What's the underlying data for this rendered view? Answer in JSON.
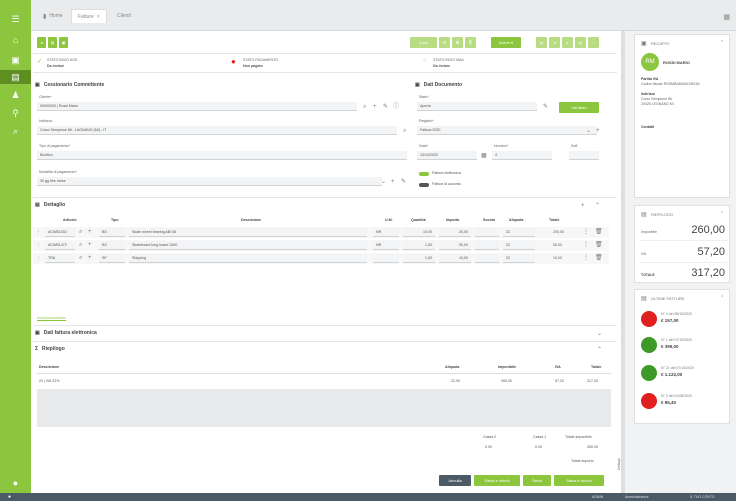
{
  "tabs": [
    {
      "label": "Home"
    },
    {
      "label": "Fatture"
    },
    {
      "label": "Clienti"
    }
  ],
  "toolbar": {
    "btn_invia": "Invia",
    "btn_azioni": "Azioni"
  },
  "status": {
    "invio_label": "STATO INVIO ASD",
    "invio_value": "Da inviare",
    "pag_label": "STATO PAGAMENTO",
    "pag_value": "Non pagato",
    "inv_label": "STATO INVIO MAIL",
    "inv_value": "Da inviare"
  },
  "cessionario": {
    "title": "Cessionario Committente",
    "cliente_label": "Cliente*",
    "cliente_value": "00000002 | Rossi Mario",
    "indirizzo_label": "Indirizzo",
    "indirizzo_value": "Corso Sempione 86 - LAGNANO (MI) - IT",
    "tipo_pag_label": "Tipo di pagamento*",
    "tipo_pag_value": "Bonifico",
    "modalita_label": "Modalità di pagamento*",
    "modalita_value": "30 gg fine mese"
  },
  "documento": {
    "title": "Dati Documento",
    "stato_label": "Stato*",
    "stato_value": "Aperta",
    "registro_label": "Registro*",
    "registro_value": "Fattura 2020",
    "data_label": "Data*",
    "data_value": "13/10/2020",
    "numero_label": "Numero*",
    "numero_value": "4",
    "suff_label": "Suff.",
    "action_btn": "Vai aiuto",
    "toggle1": "Fattura elettronica",
    "toggle2": "Fattura di acconto"
  },
  "dettaglio": {
    "title": "Dettaglio",
    "columns": [
      "Articolo",
      "Tipo",
      "Descrizione",
      "U.M.",
      "Quantità",
      "Importo",
      "Sconto",
      "Aliquota",
      "Totale"
    ],
    "rows": [
      {
        "articolo": "ACWB1002",
        "tipo": "BS",
        "descr": "Skate wheel bearing ABI 68",
        "um": "NR",
        "qta": "10,00",
        "importo": "20,00",
        "aliquota": "22",
        "totale": "200,00"
      },
      {
        "articolo": "ACWB1472",
        "tipo": "BS",
        "descr": "Skateboard long board 1500",
        "um": "NR",
        "qta": "1,00",
        "importo": "50,00",
        "aliquota": "22",
        "totale": "50,00"
      },
      {
        "articolo": "TRA",
        "tipo": "SP",
        "descr": "Shipping",
        "um": "",
        "qta": "1,00",
        "importo": "10,00",
        "aliquota": "22",
        "totale": "10,00"
      }
    ],
    "link": "Includi documento"
  },
  "fe": {
    "title": "Dati fattura elettronica"
  },
  "riepilogo": {
    "title": "Riepilogo",
    "columns": [
      "Descrizione",
      "Aliquota",
      "Imponibile",
      "IVA",
      "Totale"
    ],
    "row": {
      "descr": "22 | IVA 22%",
      "aliquota": "22,00",
      "imponibile": "260,00",
      "iva": "57,20",
      "totale": "317,20"
    },
    "cassa2_label": "Cassa 2",
    "cassa2_value": "0,00",
    "cassa1_label": "Cassa 1",
    "cassa1_value": "0,00",
    "tot_imp_label": "Totale imponibile",
    "tot_imp_value": "260,00",
    "tot_importo_label": "Totale importo"
  },
  "actions": {
    "annulla": "Annulla",
    "salva_chiudi": "Salva e chiudi",
    "salva": "Salva",
    "salva_nuovo": "Salva e nuovo"
  },
  "side": {
    "recapiti_title": "RECAPITI",
    "client_initials": "RM",
    "client_name": "ROSSI MARIO",
    "piva_label": "Partita IVA",
    "cf_label": "Codice fiscale",
    "cf_value": "RSSMRA80A01H501B",
    "indirizzo_label": "Indirizzo",
    "indirizzo_l1": "Corso Sempione 86",
    "indirizzo_l2": "20025 LEGNANO MI",
    "contatti_label": "Contatti",
    "riepilogo_title": "RIEPILOGO",
    "imponibile_label": "Imponibile",
    "imponibile_value": "260,00",
    "iva_label": "IVA",
    "iva_value": "57,20",
    "totale_label": "TOTALE",
    "totale_value": "317,20",
    "ultime_title": "ULTIME FATTURE",
    "invoices": [
      {
        "line1": "N° 4 del 08/10/2020",
        "amount": "€ 157,00",
        "color": "#e02020"
      },
      {
        "line1": "N° 1 del 07/10/2020",
        "amount": "€ 399,00",
        "color": "#3e9a28"
      },
      {
        "line1": "N° 21 del 07/10/2020",
        "amount": "€ 1.122,00",
        "color": "#3e9a28"
      },
      {
        "line1": "N° 2 del 01/08/2020",
        "amount": "€ 85,40",
        "color": "#e02020"
      }
    ],
    "vertical_label": "Dettagli"
  },
  "footer": {
    "item1": "ADMIN",
    "item2": "Amministratore",
    "item3": "IL TUO CONTO"
  },
  "colors": {
    "accent": "#8cc63f",
    "accent_dark": "#5f8f20",
    "bottombar": "#4c5a66"
  }
}
